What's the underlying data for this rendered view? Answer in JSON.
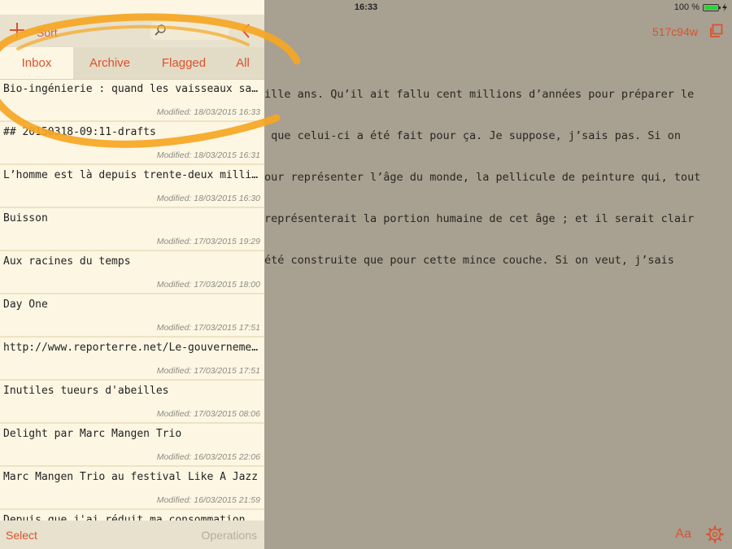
{
  "status_bar": {
    "device": "iPad",
    "time": "16:33",
    "battery_text": "100 %",
    "battery_level": 1.0
  },
  "sidebar": {
    "header": {
      "add_icon": "plus-icon",
      "sort_label": "Sort",
      "search_placeholder": "",
      "back_icon": "chevron-left-icon"
    },
    "tabs": [
      {
        "label": "Inbox",
        "active": true
      },
      {
        "label": "Archive",
        "active": false
      },
      {
        "label": "Flagged",
        "active": false
      },
      {
        "label": "All",
        "active": false
      }
    ],
    "notes": [
      {
        "title": "Bio-ingénierie : quand les vaisseaux sanguins",
        "modified": "Modified: 18/03/2015 16:33"
      },
      {
        "title": "## 20150318-09:11-drafts",
        "modified": "Modified: 18/03/2015 16:31"
      },
      {
        "title": "L’homme est là depuis trente-deux millions",
        "modified": "Modified: 18/03/2015 16:30"
      },
      {
        "title": "Buisson",
        "modified": "Modified: 17/03/2015 19:29"
      },
      {
        "title": "Aux racines du temps",
        "modified": "Modified: 17/03/2015 18:00"
      },
      {
        "title": "Day One",
        "modified": "Modified: 17/03/2015 17:51"
      },
      {
        "title": "http://www.reporterre.net/Le-gouvernement",
        "modified": "Modified: 17/03/2015 17:51"
      },
      {
        "title": "Inutiles tueurs d'abeilles",
        "modified": "Modified: 17/03/2015 08:06"
      },
      {
        "title": "Delight par Marc Mangen Trio",
        "modified": "Modified: 16/03/2015 22:06"
      },
      {
        "title": "Marc Mangen Trio au festival Like A Jazz",
        "modified": "Modified: 16/03/2015 21:59"
      },
      {
        "title": "Depuis que j'ai réduit ma consommation de",
        "modified": ""
      }
    ],
    "footer": {
      "select_label": "Select",
      "operations_label": "Operations"
    }
  },
  "editor": {
    "doc_id": "517c94w",
    "share_icon": "share-icon",
    "lines": [
      "ille ans. Qu’il ait fallu cent millions d’années pour préparer le",
      " que celui-ci a été fait pour ça. Je suppose, j’sais pas. Si on",
      "our représenter l’âge du monde, la pellicule de peinture qui, tout",
      "représenterait la portion humaine de cet âge ; et il serait clair",
      "été construite que pour cette mince couche. Si on veut, j’sais"
    ],
    "font_button": "Aa",
    "settings_icon": "gear-icon"
  },
  "colors": {
    "accent": "#d9532f",
    "annotation": "#f5a623"
  }
}
